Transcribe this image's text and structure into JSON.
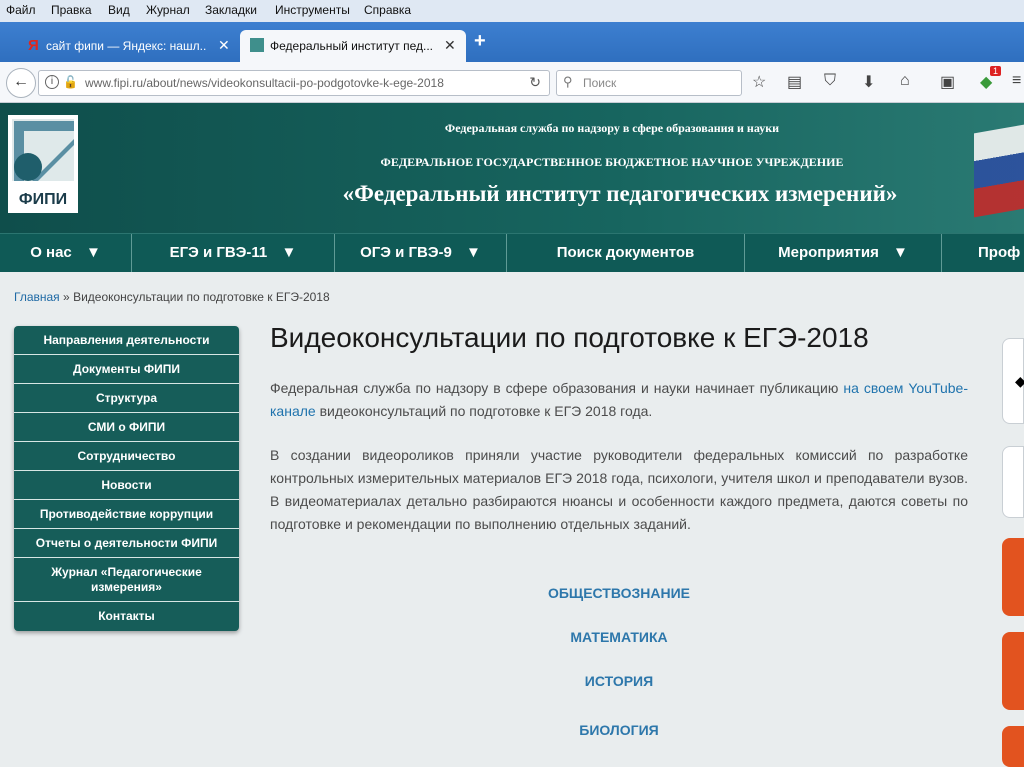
{
  "menu": [
    "Файл",
    "Правка",
    "Вид",
    "Журнал",
    "Закладки",
    "Инструменты",
    "Справка"
  ],
  "tabs": [
    {
      "title": "сайт фипи — Яндекс: нашл...",
      "icon": "yandex-icon"
    },
    {
      "title": "Федеральный институт пед...",
      "icon": "fipi-icon"
    }
  ],
  "url": "www.fipi.ru/about/news/videokonsultacii-po-podgotovke-k-ege-2018",
  "search_placeholder": "Поиск",
  "notification_badge": "1",
  "header": {
    "line1": "Федеральная служба по надзору в сфере образования и науки",
    "line2": "ФЕДЕРАЛЬНОЕ ГОСУДАРСТВЕННОЕ БЮДЖЕТНОЕ НАУЧНОЕ УЧРЕЖДЕНИЕ",
    "line3": "«Федеральный институт педагогических измерений»",
    "logo_text": "ФИПИ"
  },
  "nav": [
    "О нас",
    "ЕГЭ и ГВЭ-11",
    "ОГЭ и ГВЭ-9",
    "Поиск документов",
    "Мероприятия",
    "Проф"
  ],
  "breadcrumb": {
    "home": "Главная",
    "sep": "»",
    "current": "Видеоконсультации по подготовке к ЕГЭ-2018"
  },
  "sidebar": [
    "Направления деятельности",
    "Документы ФИПИ",
    "Структура",
    "СМИ о ФИПИ",
    "Сотрудничество",
    "Новости",
    "Противодействие коррупции",
    "Отчеты о деятельности ФИПИ",
    "Журнал «Педагогические измерения»",
    "Контакты"
  ],
  "article": {
    "title": "Видеоконсультации по подготовке к ЕГЭ-2018",
    "p1_start": "Федеральная служба по надзору в сфере образования и науки начинает публикацию ",
    "p1_link": "на своем YouTube-канале",
    "p1_end": " видеоконсультаций по подготовке к ЕГЭ 2018 года.",
    "p2": "В создании видеороликов приняли участие руководители федеральных комиссий по разработке контрольных измерительных материалов ЕГЭ 2018 года, психологи, учителя школ и преподаватели вузов. В видеоматериалах детально разбираются нюансы и особенности каждого предмета, даются советы по подготовке и рекомендации по выполнению отдельных заданий.",
    "subjects": [
      "ОБЩЕСТВОЗНАНИЕ",
      "МАТЕМАТИКА",
      "ИСТОРИЯ",
      "БИОЛОГИЯ"
    ]
  },
  "colors": {
    "teal": "#165d59",
    "link": "#1f73ad",
    "browser_blue": "#3d7fd0"
  }
}
